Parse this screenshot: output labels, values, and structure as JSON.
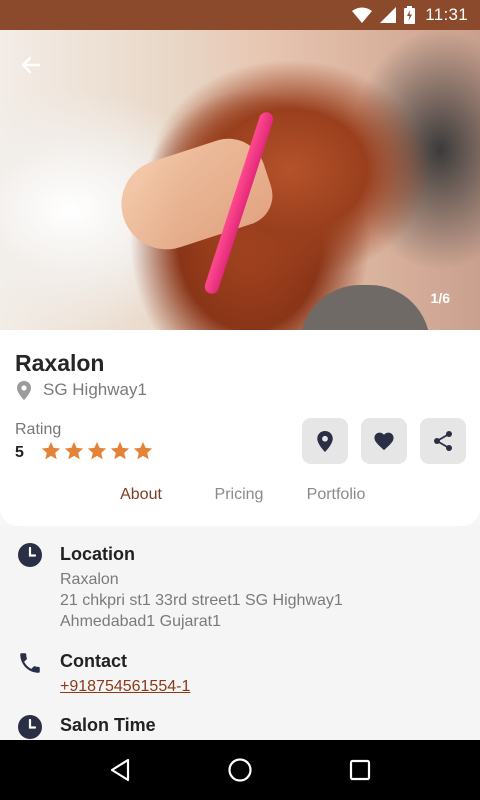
{
  "status_bar": {
    "time": "11:31",
    "bar_color": "#8b4a2b"
  },
  "hero": {
    "counter": "1/6",
    "back_icon": "arrow-left-icon"
  },
  "salon": {
    "name": "Raxalon",
    "location": "SG Highway1",
    "rating_label": "Rating",
    "rating_value": "5",
    "stars": 5
  },
  "actions": [
    {
      "name": "map-pin",
      "icon": "map-pin-icon"
    },
    {
      "name": "favorite",
      "icon": "heart-icon"
    },
    {
      "name": "share",
      "icon": "share-icon"
    }
  ],
  "tabs": [
    {
      "label": "About",
      "active": true
    },
    {
      "label": "Pricing",
      "active": false
    },
    {
      "label": "Portfolio",
      "active": false
    }
  ],
  "about": {
    "location": {
      "title": "Location",
      "lines": [
        "Raxalon",
        "21 chkpri st1 33rd street1 SG Highway1",
        "Ahmedabad1 Gujarat1"
      ]
    },
    "contact": {
      "title": "Contact",
      "phone": "+918754561554-1"
    },
    "salon_time": {
      "title": "Salon Time"
    }
  },
  "colors": {
    "accent": "#7a3f20",
    "star": "#e5823a",
    "link": "#8b3a18",
    "icon_dark": "#2b2f45"
  }
}
